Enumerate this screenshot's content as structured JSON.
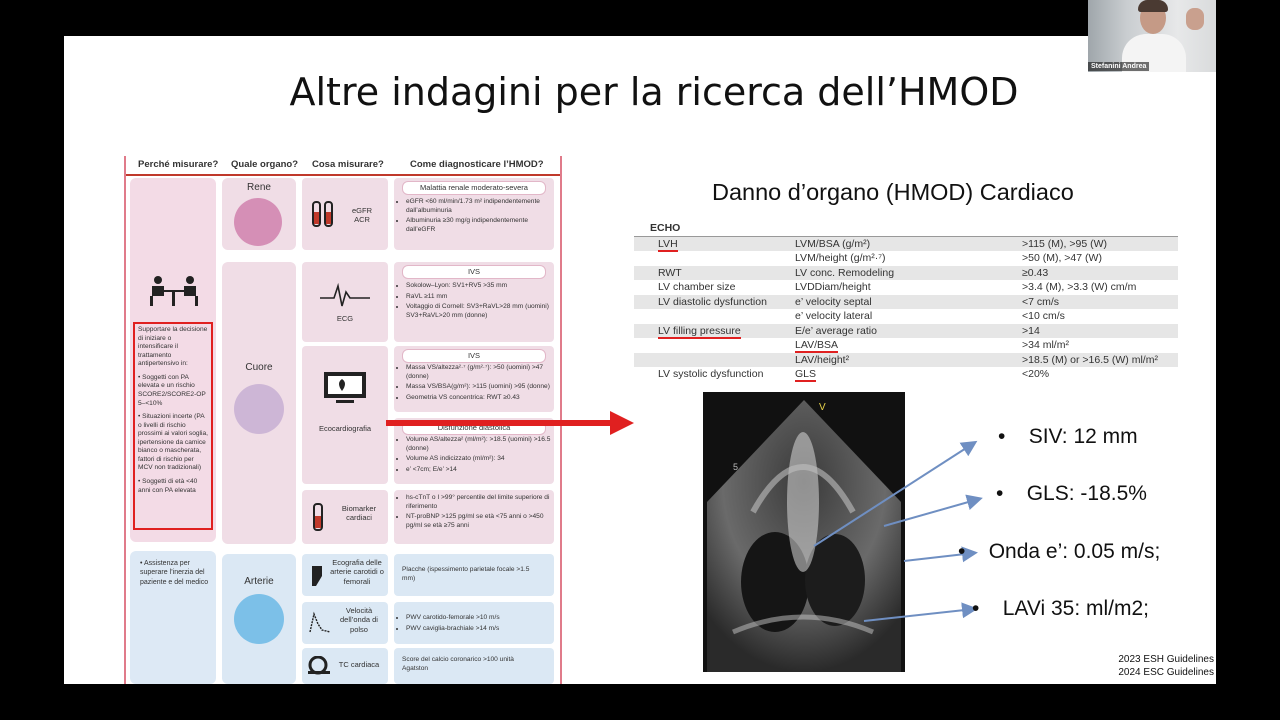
{
  "slide": {
    "title": "Altre indagini per la ricerca dell’HMOD",
    "subtitle": "Danno d’organo (HMOD) Cardiaco",
    "footer": [
      "2023 ESH Guidelines",
      "2024 ESC Guidelines"
    ]
  },
  "webcam": {
    "name": "Stefanini Andrea"
  },
  "infographic": {
    "headers": [
      "Perché misurare?",
      "Quale organo?",
      "Cosa misurare?",
      "Come diagnosticare l’HMOD?"
    ],
    "why_text": [
      "Supportare la decisione di iniziare o intensificare il trattamento antipertensivo in:",
      "• Soggetti con PA elevata e un rischio SCORE2/SCORE2-OP 5–<10%",
      "• Situazioni incerte (PA o livelli di rischio prossimi ai valori soglia, ipertensione da camice bianco o mascherata, fattori di rischio per MCV non tradizionali)",
      "• Soggetti di età <40 anni con PA elevata"
    ],
    "why2_text": "• Assistenza per superare l’inerzia del paziente e del medico",
    "organs": [
      "Rene",
      "Cuore",
      "Arterie"
    ],
    "measures": {
      "kidney": "eGFR\nACR",
      "ecg": "ECG",
      "echo": "Ecocardiografia",
      "biomarkers": "Biomarker cardiaci",
      "carotid": "Ecografia delle arterie carotidi o femorali",
      "pwv": "Velocità dell’onda di polso",
      "ct": "TC cardiaca"
    },
    "diag": {
      "kidney_title": "Malattia renale moderato-severa",
      "kidney": [
        "eGFR <60 ml/min/1.73 m² indipendentemente dall’albuminuria",
        "Albuminuria ≥30 mg/g indipendentemente dall’eGFR"
      ],
      "ecg_title": "IVS",
      "ecg": [
        "Sokolow–Lyon: SV1+RV5 >35 mm",
        "RaVL ≥11 mm",
        "Voltaggio di Cornell: SV3+RaVL>28 mm (uomini) SV3+RaVL>20 mm (donne)"
      ],
      "echo_title": "IVS",
      "echo": [
        "Massa VS/altezza²·⁷ (g/m²·⁷): >50 (uomini) >47 (donne)",
        "Massa VS/BSA(g/m²): >115 (uomini) >95 (donne)",
        "Geometria VS concentrica: RWT ≥0.43"
      ],
      "dd_title": "Disfunzione diastolica",
      "dd": [
        "Volume AS/altezza² (ml/m²): >18.5 (uomini) >16.5 (donne)",
        "Volume AS indicizzato (ml/m²): 34",
        "e’ <7cm; E/e’ >14"
      ],
      "bio": [
        "hs-cTnT o I >99° percentile del limite superiore di riferimento",
        "NT-proBNP >125 pg/ml se età <75 anni o >450 pg/ml se età ≥75 anni"
      ],
      "carotid": "Placche (ispessimento parietale focale >1.5 mm)",
      "pwv": [
        "PWV carotido-femorale >10 m/s",
        "PWV caviglia-brachiale >14 m/s"
      ],
      "ct": "Score del calcio coronarico >100 unità Agatston"
    }
  },
  "echo_table": {
    "header": "ECHO",
    "rows": [
      [
        "LVH",
        "LVM/BSA (g/m²)",
        ">115 (M), >95 (W)"
      ],
      [
        "",
        "LVM/height (g/m²·⁷)",
        ">50 (M), >47 (W)"
      ],
      [
        "RWT",
        "LV conc. Remodeling",
        "≥0.43"
      ],
      [
        "LV chamber size",
        "LVDDiam/height",
        ">3.4 (M), >3.3 (W) cm/m"
      ],
      [
        "LV diastolic dysfunction",
        "e’ velocity septal",
        "<7 cm/s"
      ],
      [
        "",
        "e’ velocity lateral",
        "<10 cm/s"
      ],
      [
        "LV filling pressure",
        "E/e’ average ratio",
        ">14"
      ],
      [
        "",
        "LAV/BSA",
        ">34 ml/m²"
      ],
      [
        "",
        "LAV/height²",
        ">18.5 (M) or >16.5 (W) ml/m²"
      ],
      [
        "LV systolic dysfunction",
        "GLS",
        "<20%"
      ]
    ]
  },
  "echo_image": {
    "marker": "V",
    "depth_label": "5"
  },
  "findings": [
    "SIV: 12 mm",
    "GLS: -18.5%",
    "Onda e’: 0.05 m/s;",
    "LAVi 35: ml/m2;"
  ],
  "colors": {
    "accent_red": "#e02020",
    "pink_panel": "#f0dde6",
    "blue_panel": "#dbe8f4",
    "arrow_blue": "#6f8fc2"
  }
}
